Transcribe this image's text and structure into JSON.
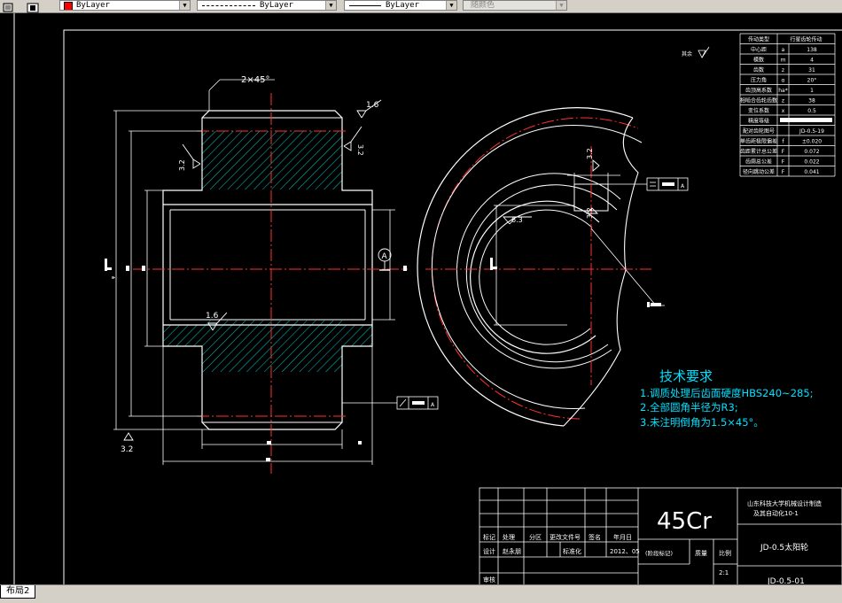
{
  "toolbar": {
    "color_combo": "ByLayer",
    "linetype_combo": "ByLayer",
    "lineweight_combo": "ByLayer",
    "plotstyle_combo": "随颜色"
  },
  "drawing": {
    "chamfer_note": "2×45°",
    "roughness_top": "1.6",
    "roughness_bore": "1.6",
    "roughness_side": "3.2",
    "roughness_left": "3.2",
    "roughness_bottom": "3.2",
    "roughness_right": "3.2",
    "roughness_keyway": "6.3",
    "roughness_keyway_side": "3.2",
    "datum_label": "A",
    "tol_right_datum": "A",
    "tol_bottom_datum": "A",
    "other_roughness": "其余",
    "tech_title": "技术要求",
    "tech_notes": [
      "1.调质处理后齿面硬度HBS240~285;",
      "2.全部圆角半径为R3;",
      "3.未注明倒角为1.5×45°。"
    ]
  },
  "param_table": {
    "header": [
      "传动类型",
      "行星齿轮传动"
    ],
    "rows": [
      [
        "中心距",
        "a",
        "138"
      ],
      [
        "模数",
        "m",
        "4"
      ],
      [
        "齿数",
        "z",
        "31"
      ],
      [
        "压力角",
        "α",
        "20°"
      ],
      [
        "齿顶高系数",
        "ha*",
        "1"
      ],
      [
        "相啮合齿轮齿数",
        "z",
        "38"
      ],
      [
        "变位系数",
        "x",
        "0.5"
      ],
      [
        "精度等级",
        "",
        ""
      ],
      [
        "配对齿轮图号",
        "",
        "JD-0.5-19"
      ],
      [
        "单齿距极限偏差",
        "f",
        "±0.020"
      ],
      [
        "齿距累计总公差",
        "F",
        "0.072"
      ],
      [
        "齿廓总公差",
        "F",
        "0.022"
      ],
      [
        "径向跳动公差",
        "F",
        "0.041"
      ]
    ]
  },
  "title_block": {
    "material": "45Cr",
    "school_line1": "山东科技大学机械设计制造",
    "school_line2": "及其自动化10-1",
    "part_name": "JD-0.5太阳轮",
    "drawing_no": "JD-0.5-01",
    "row_labels": [
      "标记",
      "处理",
      "分区",
      "更改文件号",
      "签名",
      "年月日"
    ],
    "design_label": "设计",
    "designer": "赵永朋",
    "standard_label": "标准化",
    "date": "2012、05",
    "stage_label": "(阶段标记)",
    "weight_label": "质量",
    "scale_label": "比例",
    "scale": "2:1",
    "review_label": "审核"
  },
  "layout_tab": "布局2"
}
